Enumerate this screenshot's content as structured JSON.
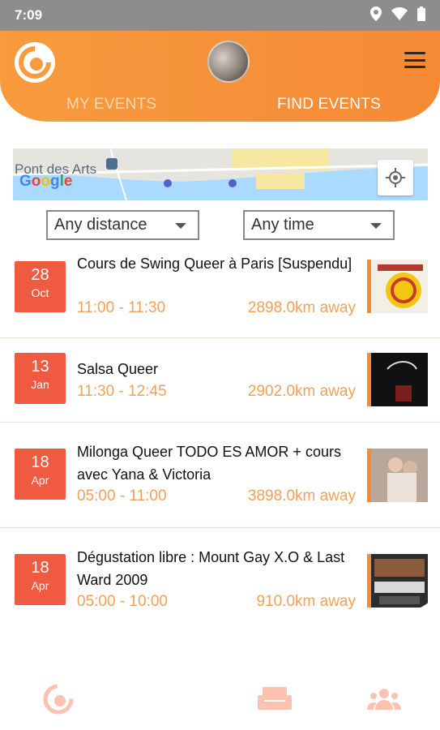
{
  "status": {
    "time": "7:09",
    "icons": [
      "location-icon",
      "wifi-icon",
      "battery-icon"
    ]
  },
  "header": {
    "tabs": [
      {
        "label": "MY EVENTS",
        "active": false
      },
      {
        "label": "FIND EVENTS",
        "active": true
      }
    ],
    "colors": {
      "accent": "#f68a35",
      "date_badge": "#f05a40",
      "time_text": "#f4a058"
    }
  },
  "map": {
    "place_label": "Pont des Arts",
    "provider": "Google"
  },
  "filters": {
    "distance": "Any distance",
    "time": "Any time"
  },
  "events": [
    {
      "day": "28",
      "month": "Oct",
      "title": "Cours de Swing Queer à Paris [Suspendu]",
      "time": "11:00 - 11:30",
      "distance": "2898.0km away"
    },
    {
      "day": "13",
      "month": "Jan",
      "title": "Salsa Queer",
      "time": "11:30 - 12:45",
      "distance": "2902.0km away"
    },
    {
      "day": "18",
      "month": "Apr",
      "title": "Milonga Queer TODO ES AMOR + cours avec Yana & Victoria",
      "time": "05:00 - 11:00",
      "distance": "3898.0km away"
    },
    {
      "day": "18",
      "month": "Apr",
      "title": "Dégustation libre : Mount Gay X.O & Last Ward 2009",
      "time": "05:00 - 10:00",
      "distance": "910.0km away"
    }
  ],
  "bottom_nav": [
    "app-logo-icon",
    "calendar-icon",
    "sofa-icon",
    "group-icon"
  ]
}
